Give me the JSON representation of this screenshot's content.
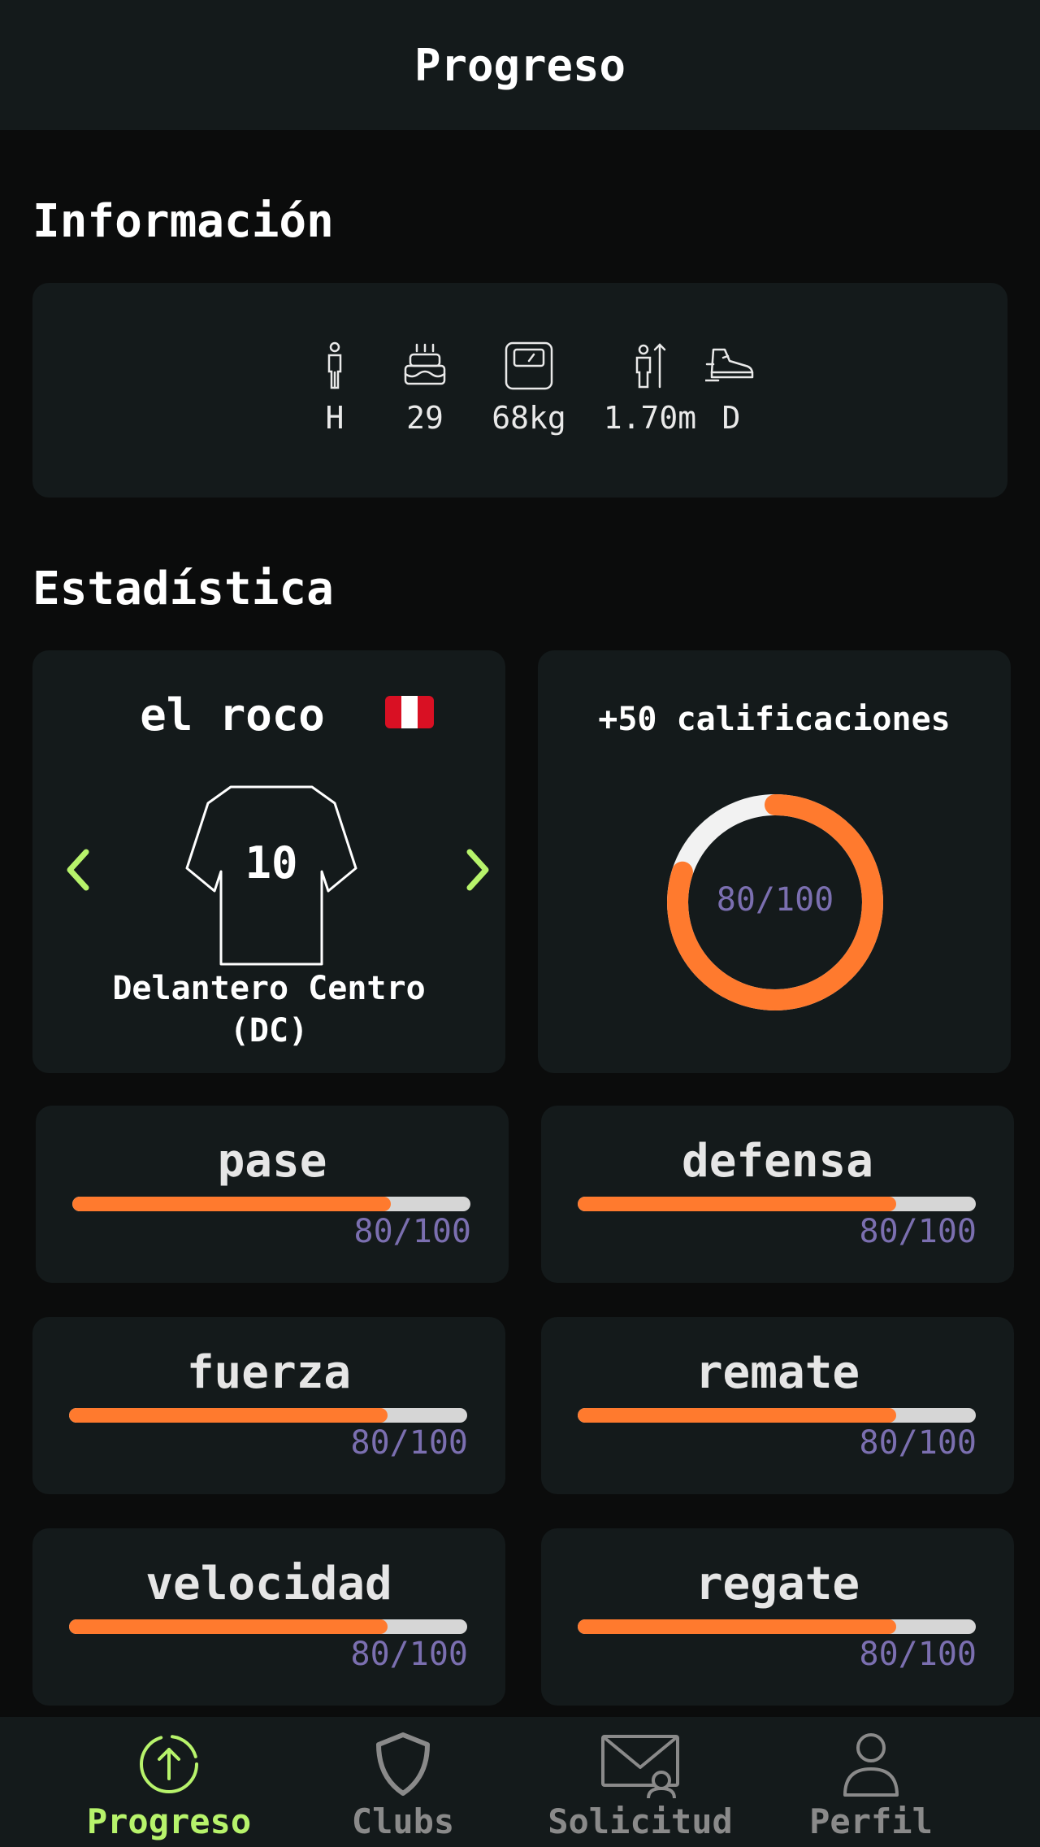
{
  "app_bar": {
    "title": "Progreso"
  },
  "info": {
    "title": "Información",
    "items": [
      {
        "icon": "person-icon",
        "value": "H"
      },
      {
        "icon": "cake-icon",
        "value": "29"
      },
      {
        "icon": "scale-icon",
        "value": "68kg"
      },
      {
        "icon": "height-icon",
        "value": "1.70m"
      },
      {
        "icon": "shoe-icon",
        "value": "D"
      }
    ]
  },
  "stats": {
    "title": "Estadística",
    "player": {
      "name": "el roco",
      "flag_colors": [
        "#d91023",
        "#ffffff",
        "#d91023"
      ],
      "shirt_number": "10",
      "position_line1": "Delantero Centro",
      "position_line2": "(DC)"
    },
    "rating": {
      "title": "+50 calificaciones",
      "label": "80/100",
      "value": 80,
      "max": 100
    },
    "attributes": [
      {
        "name": "pase",
        "label": "80/100",
        "value": 80
      },
      {
        "name": "defensa",
        "label": "80/100",
        "value": 80
      },
      {
        "name": "fuerza",
        "label": "80/100",
        "value": 80
      },
      {
        "name": "remate",
        "label": "80/100",
        "value": 80
      },
      {
        "name": "velocidad",
        "label": "80/100",
        "value": 80
      },
      {
        "name": "regate",
        "label": "80/100",
        "value": 80
      }
    ]
  },
  "colors": {
    "accent": "#ff7a2e",
    "nav_active": "#b7f36b",
    "value_text": "#7b6fb0",
    "card": "#141a1b",
    "background": "#0b0c0c"
  },
  "nav": [
    {
      "icon": "progress-arrow-icon",
      "label": "Progreso",
      "active": true
    },
    {
      "icon": "shield-icon",
      "label": "Clubs",
      "active": false
    },
    {
      "icon": "mail-user-icon",
      "label": "Solicitud",
      "active": false
    },
    {
      "icon": "user-icon",
      "label": "Perfil",
      "active": false
    }
  ]
}
